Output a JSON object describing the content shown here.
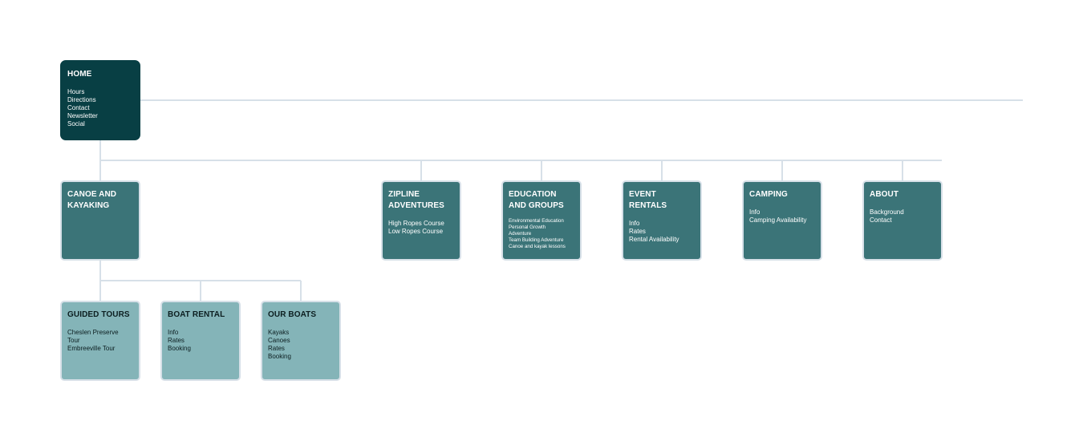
{
  "colors": {
    "root": "#083f44",
    "level1": "#3b7478",
    "level2": "#84b4b8",
    "connector": "#d7e0e8"
  },
  "sitemap": {
    "home": {
      "title": "HOME",
      "items": [
        "Hours",
        "Directions",
        "Contact",
        "Newsletter",
        "Social"
      ]
    },
    "canoe": {
      "title": "CANOE AND\nKAYAKING",
      "items": []
    },
    "zipline": {
      "title": "ZIPLINE\nADVENTURES",
      "items": [
        "High Ropes Course",
        "Low Ropes Course"
      ]
    },
    "education": {
      "title": "EDUCATION\nAND GROUPS",
      "items": [
        "Environmental Education",
        "Personal Growth",
        "Adventure",
        "Team Building Adventure",
        "Canoe and kayak lessons"
      ]
    },
    "events": {
      "title": "EVENT RENTALS",
      "items": [
        "Info",
        "Rates",
        "Rental Availability"
      ]
    },
    "camping": {
      "title": "CAMPING",
      "items": [
        "Info",
        "Camping Availability"
      ]
    },
    "about": {
      "title": "ABOUT",
      "items": [
        "Background",
        "Contact"
      ]
    },
    "tours": {
      "title": "GUIDED TOURS",
      "items": [
        "Cheslen Preserve",
        "Tour",
        "Embreeville Tour"
      ]
    },
    "rental": {
      "title": "BOAT RENTAL",
      "items": [
        "Info",
        "Rates",
        "Booking"
      ]
    },
    "boats": {
      "title": "OUR BOATS",
      "items": [
        "Kayaks",
        "Canoes",
        "Rates",
        "Booking"
      ]
    }
  }
}
